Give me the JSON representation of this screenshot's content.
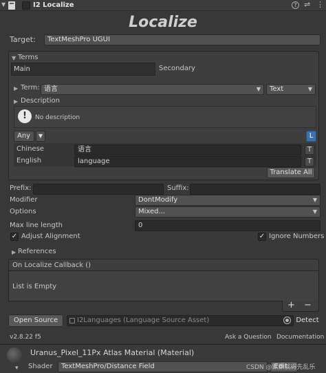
{
  "header": {
    "title": "I2 Localize",
    "component_checked": true
  },
  "banner": {
    "title": "Localize"
  },
  "target": {
    "label": "Target:",
    "value": "TextMeshPro UGUI"
  },
  "terms": {
    "label": "Terms",
    "tabs": [
      "Main",
      "Secondary"
    ],
    "term_label": "Term:",
    "term_value": "语言",
    "term_type": "Text",
    "description_label": "Description",
    "description_text": "No description",
    "filter_value": "Any",
    "l_button": "L",
    "languages": [
      {
        "name": "Chinese",
        "value": "语言",
        "t": "T"
      },
      {
        "name": "English",
        "value": "language",
        "t": "T"
      }
    ],
    "translate_all": "Translate All"
  },
  "prefix": {
    "label": "Prefix:",
    "value": ""
  },
  "suffix": {
    "label": "Suffix:",
    "value": ""
  },
  "modifier": {
    "label": "Modifier",
    "value": "DontModify"
  },
  "options": {
    "label": "Options",
    "value": "Mixed..."
  },
  "max_line_length": {
    "label": "Max line length",
    "value": "0"
  },
  "adjust_alignment": {
    "label": "Adjust Alignment",
    "checked": true
  },
  "ignore_numbers": {
    "label": "Ignore Numbers",
    "checked": true
  },
  "references": {
    "label": "References"
  },
  "callback": {
    "label": "On Localize Callback ()",
    "empty_text": "List is Empty",
    "add": "+",
    "remove": "−"
  },
  "source": {
    "open_button": "Open Source",
    "field_value": "I2Languages (Language Source Asset)",
    "detect_button": "Detect"
  },
  "footer": {
    "version": "v2.8.22 f5",
    "ask": "Ask a Question",
    "docs": "Documentation"
  },
  "material": {
    "title": "Uranus_Pixel_11Px Atlas Material (Material)",
    "shader_label": "Shader",
    "shader_value": "TextMeshPro/Distance Field",
    "edit_button": "Edit...",
    "watermark": "CSDN @默默就得先乱乐"
  },
  "colors": {
    "background": "#383838",
    "field": "#2a2a2a",
    "accent_blue": "#3a72b0"
  }
}
